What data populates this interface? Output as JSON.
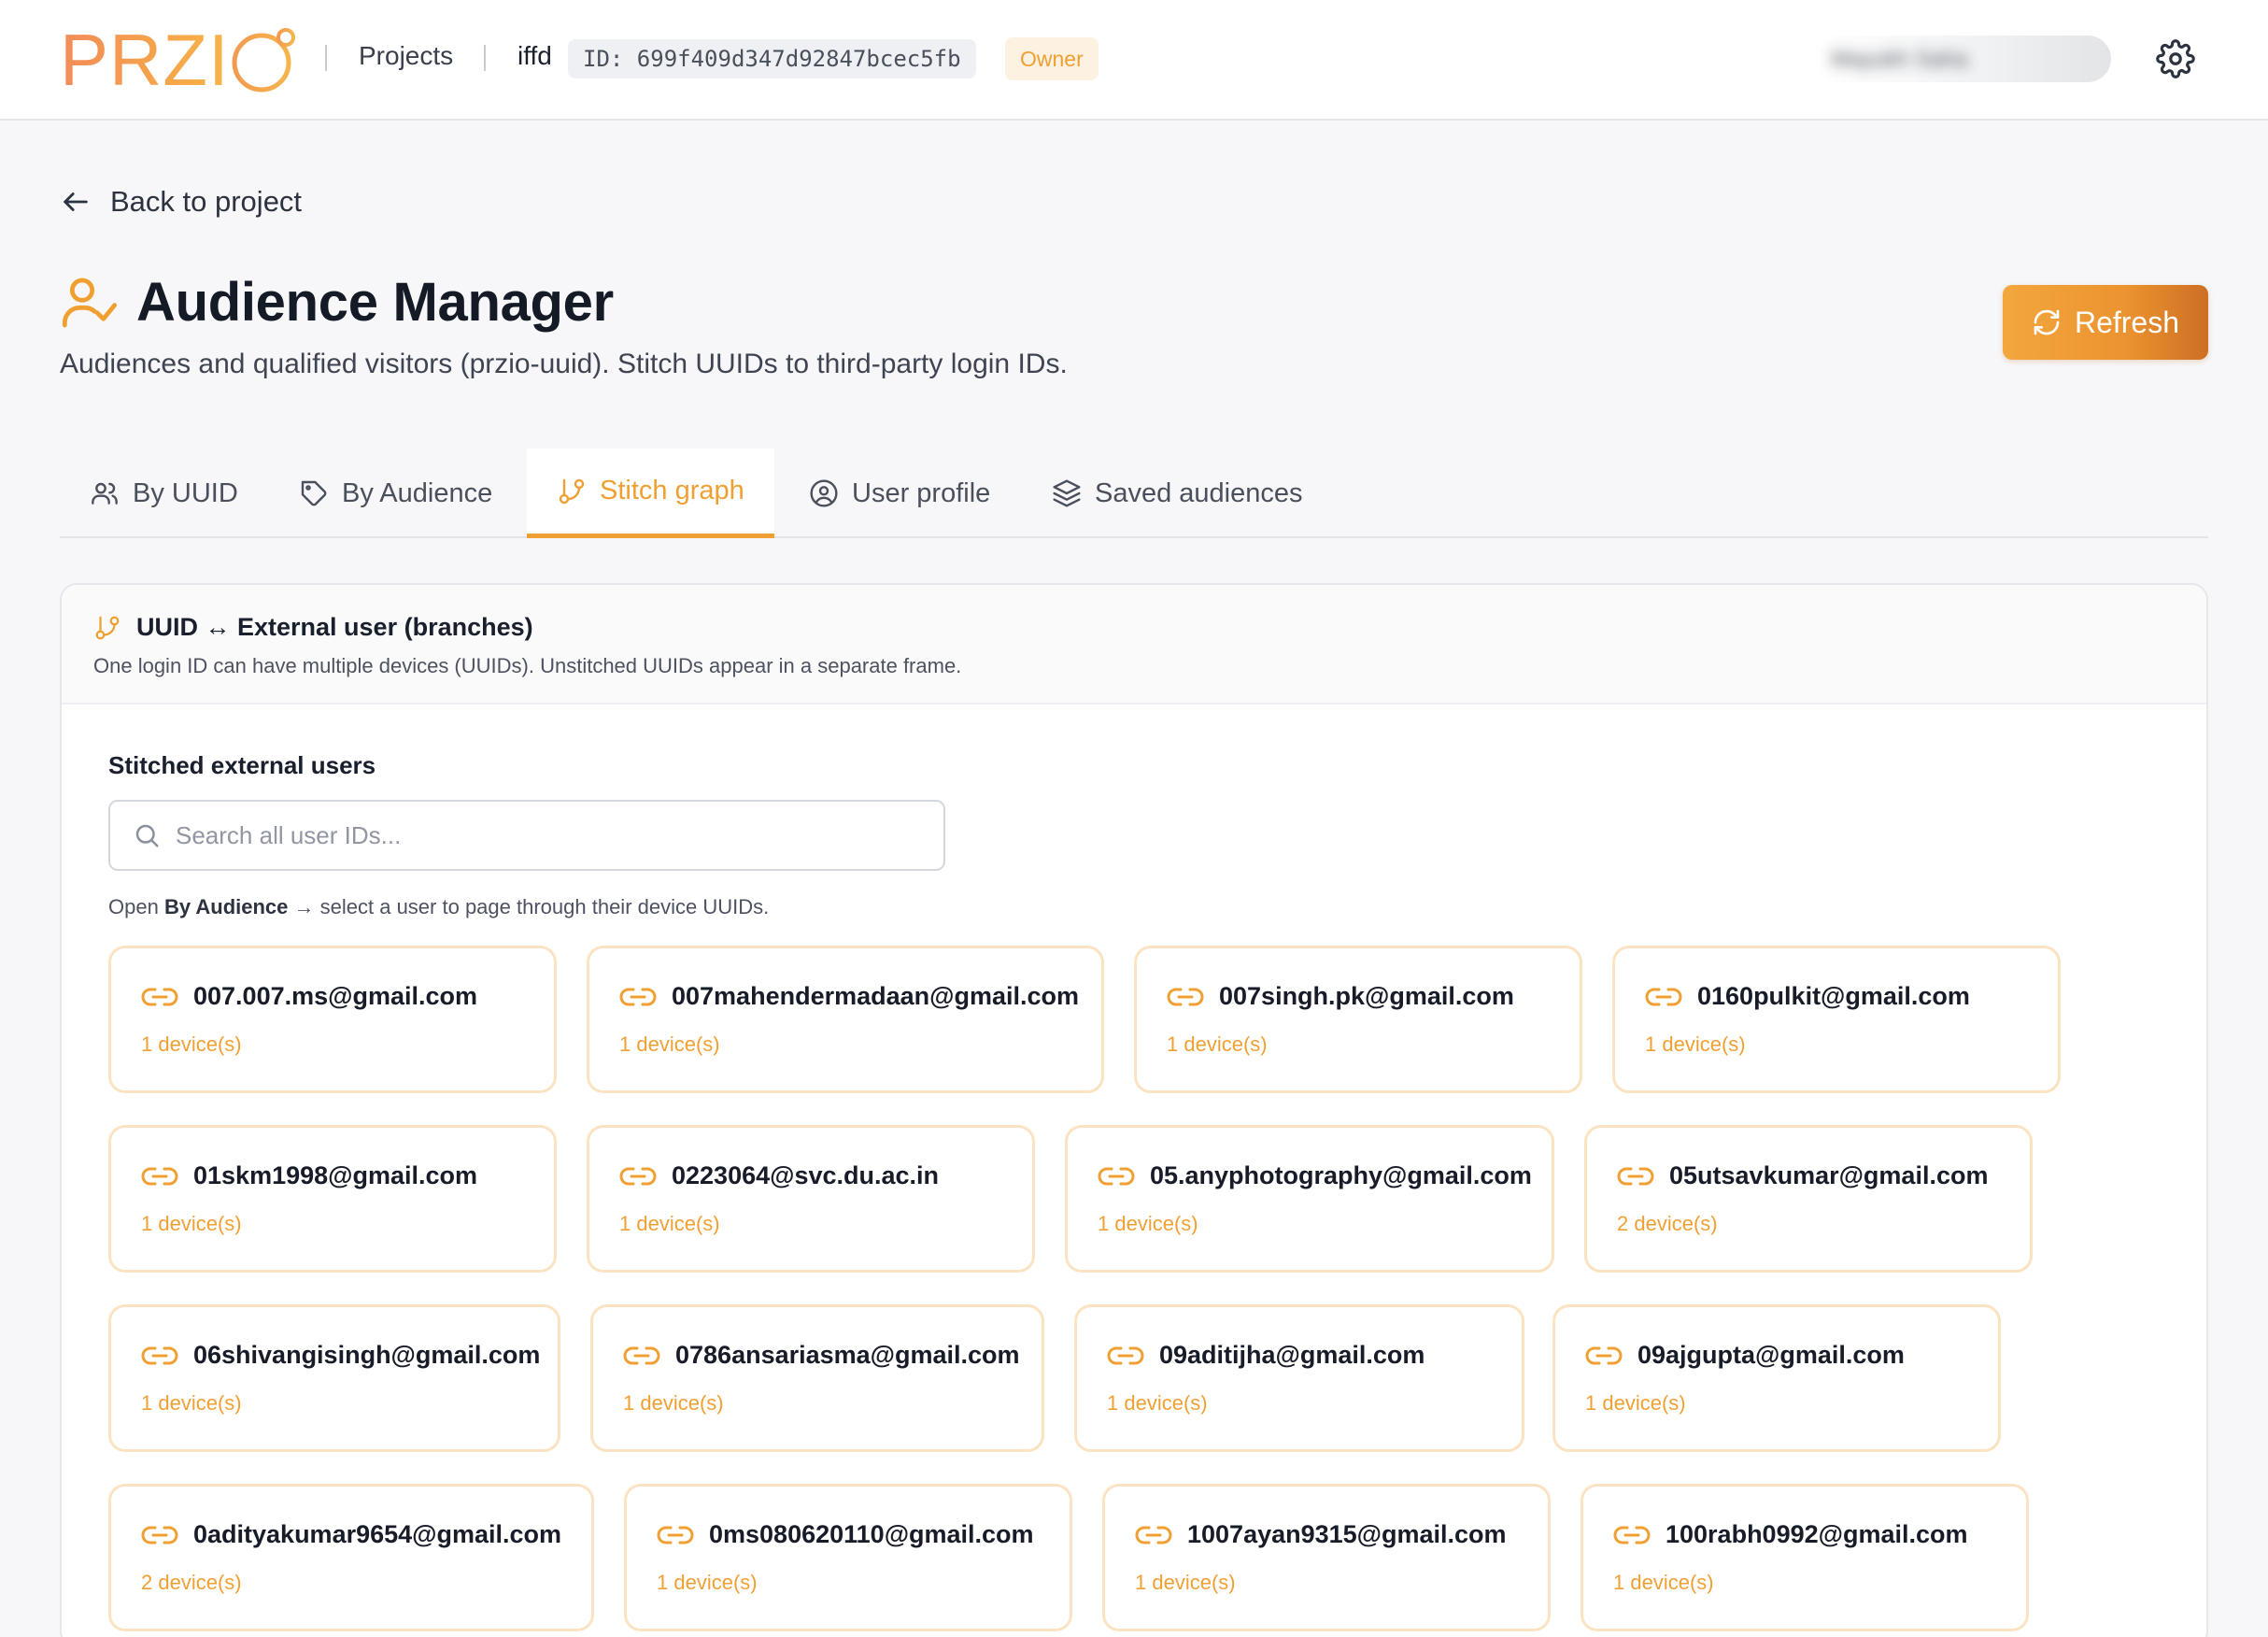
{
  "topbar": {
    "logo_text": "PRZI",
    "projects_label": "Projects",
    "project_name": "iffd",
    "project_id": "ID: 699f409d347d92847bcec5fb",
    "role_badge": "Owner",
    "user_name": "Mayukh Saha"
  },
  "back": {
    "label": "Back to project"
  },
  "header": {
    "title": "Audience Manager",
    "subtitle": "Audiences and qualified visitors (przio-uuid). Stitch UUIDs to third-party login IDs.",
    "refresh_label": "Refresh"
  },
  "tabs": [
    {
      "label": "By UUID",
      "icon": "users-icon",
      "active": false
    },
    {
      "label": "By Audience",
      "icon": "tag-icon",
      "active": false
    },
    {
      "label": "Stitch graph",
      "icon": "git-branch-icon",
      "active": true
    },
    {
      "label": "User profile",
      "icon": "user-circle-icon",
      "active": false
    },
    {
      "label": "Saved audiences",
      "icon": "layers-icon",
      "active": false
    }
  ],
  "panel": {
    "title": "UUID ↔ External user (branches)",
    "description": "One login ID can have multiple devices (UUIDs). Unstitched UUIDs appear in a separate frame.",
    "section_label": "Stitched external users",
    "search_placeholder": "Search all user IDs...",
    "hint_prefix": "Open",
    "hint_bold": "By Audience",
    "hint_suffix": "→ select a user to page through their device UUIDs."
  },
  "users": [
    {
      "email": "007.007.ms@gmail.com",
      "devices": "1 device(s)"
    },
    {
      "email": "007mahendermadaan@gmail.com",
      "devices": "1 device(s)"
    },
    {
      "email": "007singh.pk@gmail.com",
      "devices": "1 device(s)"
    },
    {
      "email": "0160pulkit@gmail.com",
      "devices": "1 device(s)"
    },
    {
      "email": "01skm1998@gmail.com",
      "devices": "1 device(s)"
    },
    {
      "email": "0223064@svc.du.ac.in",
      "devices": "1 device(s)"
    },
    {
      "email": "05.anyphotography@gmail.com",
      "devices": "1 device(s)"
    },
    {
      "email": "05utsavkumar@gmail.com",
      "devices": "2 device(s)"
    },
    {
      "email": "06shivangisingh@gmail.com",
      "devices": "1 device(s)"
    },
    {
      "email": "0786ansariasma@gmail.com",
      "devices": "1 device(s)"
    },
    {
      "email": "09aditijha@gmail.com",
      "devices": "1 device(s)"
    },
    {
      "email": "09ajgupta@gmail.com",
      "devices": "1 device(s)"
    },
    {
      "email": "0adityakumar9654@gmail.com",
      "devices": "2 device(s)"
    },
    {
      "email": "0ms080620110@gmail.com",
      "devices": "1 device(s)"
    },
    {
      "email": "1007ayan9315@gmail.com",
      "devices": "1 device(s)"
    },
    {
      "email": "100rabh0992@gmail.com",
      "devices": "1 device(s)"
    }
  ],
  "colors": {
    "accent": "#f0a033",
    "card_border": "#fbe3c2",
    "badge_bg": "#fdf1e2"
  }
}
